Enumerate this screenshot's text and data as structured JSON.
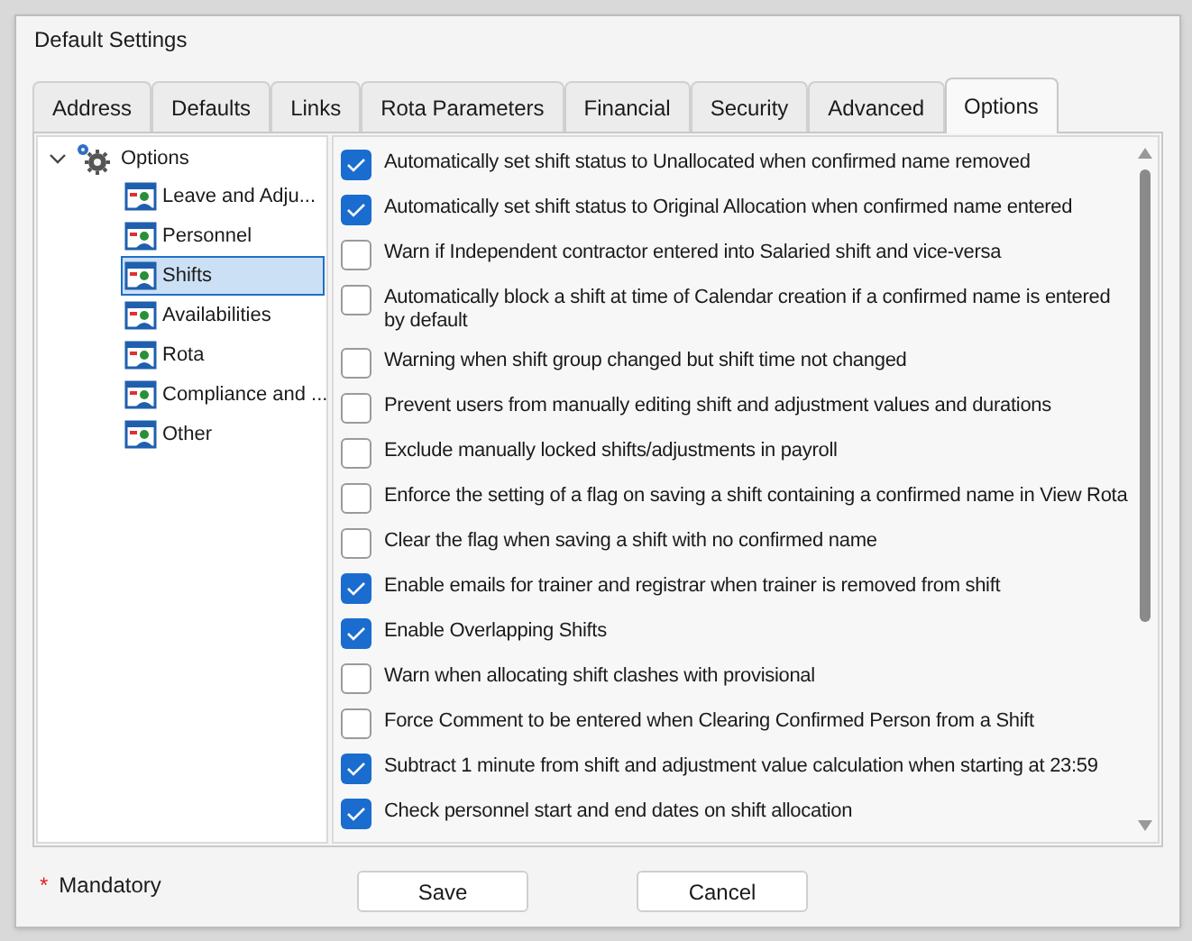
{
  "window": {
    "title": "Default Settings"
  },
  "tabs": [
    {
      "label": "Address",
      "selected": false
    },
    {
      "label": "Defaults",
      "selected": false
    },
    {
      "label": "Links",
      "selected": false
    },
    {
      "label": "Rota Parameters",
      "selected": false
    },
    {
      "label": "Financial",
      "selected": false
    },
    {
      "label": "Security",
      "selected": false
    },
    {
      "label": "Advanced",
      "selected": false
    },
    {
      "label": "Options",
      "selected": true
    }
  ],
  "tree": {
    "label": "Options",
    "expanded": true,
    "children": [
      {
        "label": "Leave and Adju...",
        "selected": false
      },
      {
        "label": "Personnel",
        "selected": false
      },
      {
        "label": "Shifts",
        "selected": true
      },
      {
        "label": "Availabilities",
        "selected": false
      },
      {
        "label": "Rota",
        "selected": false
      },
      {
        "label": "Compliance and ...",
        "selected": false
      },
      {
        "label": "Other",
        "selected": false
      }
    ]
  },
  "options": [
    {
      "label": "Automatically set shift status to Unallocated when confirmed name removed",
      "checked": true
    },
    {
      "label": "Automatically set shift status to Original Allocation when confirmed name entered",
      "checked": true
    },
    {
      "label": "Warn if Independent contractor entered into Salaried shift and vice-versa",
      "checked": false
    },
    {
      "label": "Automatically block a shift at time of Calendar creation if a confirmed name is entered by default",
      "checked": false
    },
    {
      "label": "Warning when shift group changed but shift time not changed",
      "checked": false
    },
    {
      "label": "Prevent users from manually editing shift and adjustment values and durations",
      "checked": false
    },
    {
      "label": "Exclude manually locked shifts/adjustments in payroll",
      "checked": false
    },
    {
      "label": "Enforce the setting of a flag on saving a shift containing a confirmed name in View Rota",
      "checked": false
    },
    {
      "label": "Clear the flag when saving a shift with no confirmed name",
      "checked": false
    },
    {
      "label": "Enable emails for trainer and registrar when trainer is removed from shift",
      "checked": true
    },
    {
      "label": "Enable Overlapping Shifts",
      "checked": true
    },
    {
      "label": "Warn when allocating shift clashes with provisional",
      "checked": false
    },
    {
      "label": "Force Comment to be entered when Clearing Confirmed Person from a Shift",
      "checked": false
    },
    {
      "label": "Subtract 1 minute from shift and adjustment value calculation when starting at 23:59",
      "checked": true
    },
    {
      "label": "Check personnel start and end dates on shift allocation",
      "checked": true
    }
  ],
  "mandatory": {
    "mark": "*",
    "label": "Mandatory"
  },
  "buttons": [
    "Save",
    "Cancel"
  ]
}
